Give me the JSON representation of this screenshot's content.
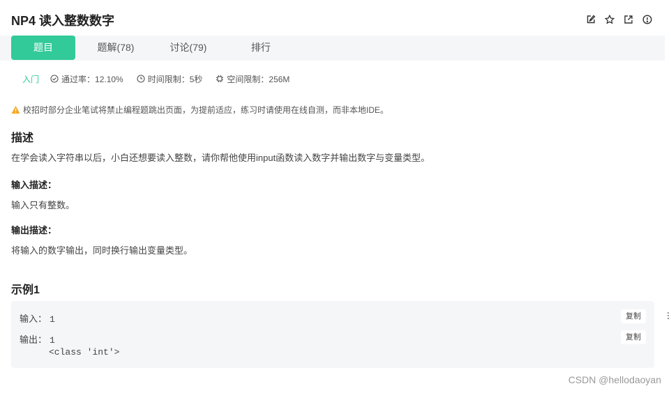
{
  "header": {
    "title": "NP4  读入整数数字",
    "icons": [
      "edit-icon",
      "star-icon",
      "share-icon",
      "info-icon"
    ]
  },
  "tabs": [
    {
      "label": "题目",
      "active": true
    },
    {
      "label": "题解(78)",
      "active": false
    },
    {
      "label": "讨论(79)",
      "active": false
    },
    {
      "label": "排行",
      "active": false
    }
  ],
  "meta": {
    "level": "入门",
    "pass_rate": "通过率：12.10%",
    "time_limit": "时间限制：5秒",
    "space_limit": "空间限制：256M"
  },
  "notice": "校招时部分企业笔试将禁止编程题跳出页面，为提前适应，练习时请使用在线自测，而非本地IDE。",
  "description": {
    "heading": "描述",
    "text": "在学会读入字符串以后，小白还想要读入整数，请你帮他使用input函数读入数字并输出数字与变量类型。"
  },
  "input_desc": {
    "heading": "输入描述：",
    "text": "输入只有整数。"
  },
  "output_desc": {
    "heading": "输出描述：",
    "text": "将输入的数字输出，同时换行输出变量类型。"
  },
  "example": {
    "heading": "示例1",
    "input_label": "输入：",
    "input_value": "1",
    "output_label": "输出：",
    "output_line1": "1",
    "output_line2": "<class 'int'>",
    "copy_label": "复制"
  },
  "watermark": "CSDN @hellodaoyan",
  "colors": {
    "accent": "#32ca99",
    "tab_bg": "#f5f6f8",
    "warning": "#f5a623"
  }
}
